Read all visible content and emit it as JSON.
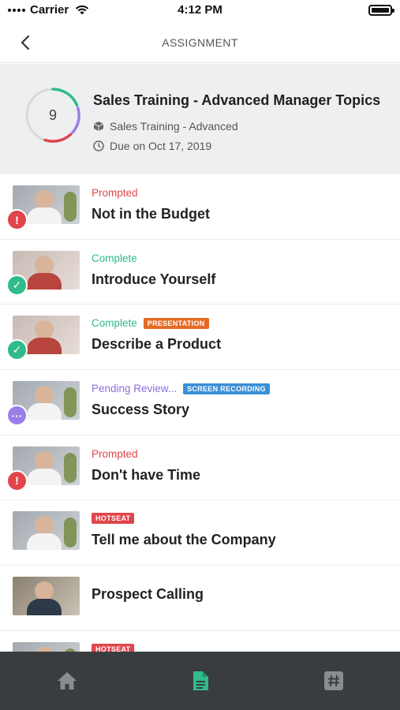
{
  "status_bar": {
    "carrier": "Carrier",
    "time": "4:12 PM"
  },
  "nav": {
    "title": "ASSIGNMENT",
    "back_icon": "chevron-left-icon"
  },
  "assignment": {
    "count": "9",
    "title": "Sales Training - Advanced Manager Topics",
    "course": "Sales Training - Advanced",
    "due": "Due on Oct 17, 2019",
    "ring_colors": [
      "#2fbb8b",
      "#9a7ee8",
      "#e0454c",
      "#d9d9d9"
    ]
  },
  "items": [
    {
      "status": "Prompted",
      "status_type": "prompted",
      "tag": "",
      "title": "Not in the Budget",
      "badge": "alert"
    },
    {
      "status": "Complete",
      "status_type": "complete",
      "tag": "",
      "title": "Introduce Yourself",
      "badge": "done"
    },
    {
      "status": "Complete",
      "status_type": "complete",
      "tag": "PRESENTATION",
      "tag_type": "presentation",
      "title": "Describe a Product",
      "badge": "done"
    },
    {
      "status": "Pending Review...",
      "status_type": "pending",
      "tag": "SCREEN RECORDING",
      "tag_type": "screen",
      "title": "Success Story",
      "badge": "pending"
    },
    {
      "status": "Prompted",
      "status_type": "prompted",
      "tag": "",
      "title": "Don't have Time",
      "badge": "alert"
    },
    {
      "status": "",
      "tag": "HOTSEAT",
      "tag_type": "hotseat",
      "title": "Tell me about the Company",
      "badge": ""
    },
    {
      "status": "",
      "tag": "",
      "title": "Prospect Calling",
      "badge": ""
    },
    {
      "status": "",
      "tag": "HOTSEAT",
      "tag_type": "hotseat",
      "title": "",
      "badge": ""
    }
  ],
  "tabs": [
    {
      "name": "home-icon",
      "color": "#8a8d90"
    },
    {
      "name": "document-icon",
      "color": "#2fbb8b"
    },
    {
      "name": "hashtag-icon",
      "color": "#8a8d90"
    }
  ]
}
